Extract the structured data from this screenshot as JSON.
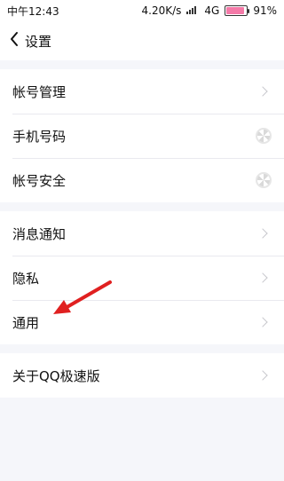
{
  "statusbar": {
    "time": "中午12:43",
    "speed": "4.20K/s",
    "network": "4G",
    "battery": "91%",
    "battery_level": 0.91
  },
  "navbar": {
    "back_icon": "chevron-left-icon",
    "title": "设置"
  },
  "groups": [
    {
      "items": [
        {
          "label": "帐号管理",
          "right": "chevron-right-icon"
        },
        {
          "label": "手机号码",
          "right": "loading-spinner-icon"
        },
        {
          "label": "帐号安全",
          "right": "loading-spinner-icon"
        }
      ]
    },
    {
      "items": [
        {
          "label": "消息通知",
          "right": "chevron-right-icon"
        },
        {
          "label": "隐私",
          "right": "chevron-right-icon"
        },
        {
          "label": "通用",
          "right": "chevron-right-icon"
        }
      ]
    },
    {
      "items": [
        {
          "label": "关于QQ极速版",
          "right": "chevron-right-icon"
        }
      ]
    }
  ],
  "annotation": {
    "icon": "red-arrow-icon",
    "color": "#e02020"
  }
}
